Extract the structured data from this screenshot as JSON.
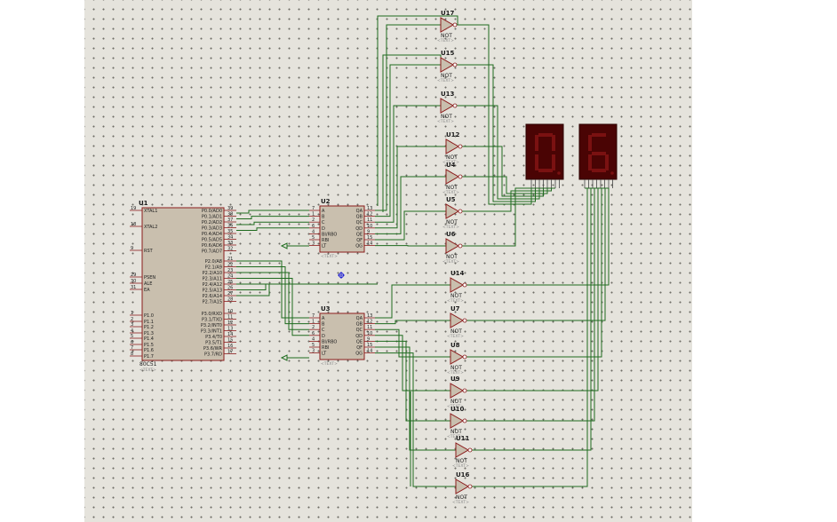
{
  "u1": {
    "ref": "U1",
    "part": "80C51",
    "text": "<TEXT>",
    "left_pins": [
      "XTAL1",
      "XTAL2",
      "RST",
      "PSEN",
      "ALE",
      "EA",
      "P1.0",
      "P1.1",
      "P1.2",
      "P1.3",
      "P1.4",
      "P1.5",
      "P1.6",
      "P1.7"
    ],
    "left_pin_numbers": [
      "19",
      "18",
      "9",
      "29",
      "30",
      "31",
      "1",
      "2",
      "3",
      "4",
      "5",
      "6",
      "7",
      "8"
    ],
    "right_pins": [
      "P0.0/AD0",
      "P0.1/AD1",
      "P0.2/AD2",
      "P0.3/AD3",
      "P0.4/AD4",
      "P0.5/AD5",
      "P0.6/AD6",
      "P0.7/AD7",
      "P2.0/A8",
      "P2.1/A9",
      "P2.2/A10",
      "P2.3/A11",
      "P2.4/A12",
      "P2.5/A13",
      "P2.6/A14",
      "P2.7/A15",
      "P3.0/RXD",
      "P3.1/TXD",
      "P3.2/INT0",
      "P3.3/INT1",
      "P3.4/T0",
      "P3.5/T1",
      "P3.6/WR",
      "P3.7/RD"
    ],
    "right_pin_numbers": [
      "39",
      "38",
      "37",
      "36",
      "35",
      "34",
      "33",
      "32",
      "21",
      "22",
      "23",
      "24",
      "25",
      "26",
      "27",
      "28",
      "10",
      "11",
      "12",
      "13",
      "14",
      "15",
      "16",
      "17"
    ]
  },
  "u2": {
    "ref": "U2",
    "text": "<TEXT>",
    "left_pins": [
      "A",
      "B",
      "C",
      "D",
      "BI/RBO",
      "RBI",
      "LT"
    ],
    "left_pin_numbers": [
      "7",
      "1",
      "2",
      "6",
      "4",
      "5",
      "3"
    ],
    "right_pins": [
      "QA",
      "QB",
      "QC",
      "QD",
      "QE",
      "QF",
      "QG"
    ],
    "right_pin_numbers": [
      "13",
      "12",
      "11",
      "10",
      "9",
      "15",
      "14"
    ]
  },
  "u3": {
    "ref": "U3",
    "text": "<TEXT>",
    "left_pins": [
      "A",
      "B",
      "C",
      "D",
      "BI/RBO",
      "RBI",
      "LT"
    ],
    "left_pin_numbers": [
      "7",
      "1",
      "2",
      "6",
      "4",
      "5",
      "3"
    ],
    "right_pins": [
      "QA",
      "QB",
      "QC",
      "QD",
      "QE",
      "QF",
      "QG"
    ],
    "right_pin_numbers": [
      "13",
      "12",
      "11",
      "10",
      "9",
      "15",
      "14"
    ]
  },
  "gates": [
    {
      "ref": "U17",
      "type": "NOT",
      "text": "<TEXT>"
    },
    {
      "ref": "U15",
      "type": "NOT",
      "text": "<TEXT>"
    },
    {
      "ref": "U13",
      "type": "NOT",
      "text": "<TEXT>"
    },
    {
      "ref": "U12",
      "type": "NOT",
      "text": "<TEXT>"
    },
    {
      "ref": "U4",
      "type": "NOT",
      "text": "<TEXT>"
    },
    {
      "ref": "U5",
      "type": "NOT",
      "text": "<TEXT>"
    },
    {
      "ref": "U6",
      "type": "NOT",
      "text": "<TEXT>"
    },
    {
      "ref": "U14",
      "type": "NOT",
      "text": "<TEXT>"
    },
    {
      "ref": "U7",
      "type": "NOT",
      "text": "<TEXT>"
    },
    {
      "ref": "U8",
      "type": "NOT",
      "text": "<TEXT>"
    },
    {
      "ref": "U9",
      "type": "NOT",
      "text": "<TEXT>"
    },
    {
      "ref": "U10",
      "type": "NOT",
      "text": "<TEXT>"
    },
    {
      "ref": "U11",
      "type": "NOT",
      "text": "<TEXT>"
    },
    {
      "ref": "U16",
      "type": "NOT",
      "text": "<TEXT>"
    }
  ],
  "displays": [
    {
      "digit": "0",
      "segment_color": "#7a1111",
      "body_color": "#4a0404"
    },
    {
      "digit": "6",
      "segment_color": "#7a1111",
      "body_color": "#4a0404"
    }
  ],
  "colors": {
    "sheet": "#e5e3dc",
    "wire": "#1e6b1e",
    "component_body": "#c9bfae",
    "component_border": "#8b1c1c",
    "marker": "#1010d0"
  }
}
